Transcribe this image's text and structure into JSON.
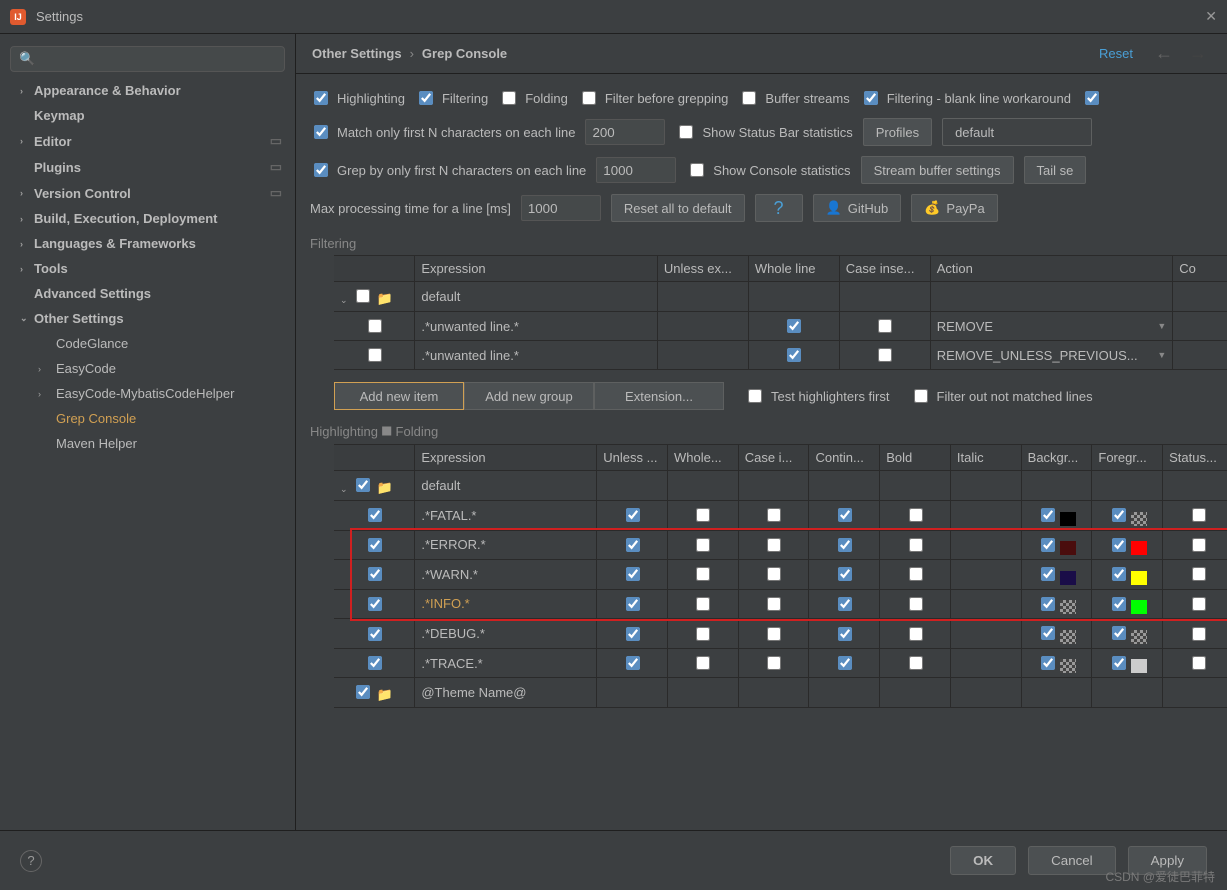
{
  "titlebar": {
    "title": "Settings"
  },
  "search": {
    "placeholder": "Q▾"
  },
  "sidebar": {
    "items": [
      {
        "label": "Appearance & Behavior",
        "chev": ">"
      },
      {
        "label": "Keymap",
        "chev": ""
      },
      {
        "label": "Editor",
        "chev": ">",
        "dots": true
      },
      {
        "label": "Plugins",
        "chev": "",
        "dots": true
      },
      {
        "label": "Version Control",
        "chev": ">",
        "dots": true
      },
      {
        "label": "Build, Execution, Deployment",
        "chev": ">"
      },
      {
        "label": "Languages & Frameworks",
        "chev": ">"
      },
      {
        "label": "Tools",
        "chev": ">"
      },
      {
        "label": "Advanced Settings",
        "chev": ""
      },
      {
        "label": "Other Settings",
        "chev": "v"
      }
    ],
    "children": [
      {
        "label": "CodeGlance"
      },
      {
        "label": "EasyCode",
        "chev": ">"
      },
      {
        "label": "EasyCode-MybatisCodeHelper",
        "chev": ">"
      },
      {
        "label": "Grep Console",
        "selected": true
      },
      {
        "label": "Maven Helper"
      }
    ]
  },
  "crumbs": {
    "a": "Other Settings",
    "b": "Grep Console",
    "reset": "Reset"
  },
  "options": {
    "highlighting": "Highlighting",
    "filtering": "Filtering",
    "folding": "Folding",
    "filterBefore": "Filter before grepping",
    "bufferStreams": "Buffer streams",
    "filteringWorkaround": "Filtering - blank line workaround",
    "matchFirstN": "Match only first N characters on each line",
    "matchN": "200",
    "showStatusBar": "Show Status Bar statistics",
    "profiles": "Profiles",
    "profileVal": "default",
    "grepFirstN": "Grep by only first N characters on each line",
    "grepN": "1000",
    "showConsole": "Show Console statistics",
    "streamBuffer": "Stream buffer settings",
    "tail": "Tail se",
    "maxTime": "Max processing time for a line [ms]",
    "maxTimeVal": "1000",
    "resetAll": "Reset all to default",
    "github": "GitHub",
    "paypal": "PayPa"
  },
  "filteringSection": "Filtering",
  "filtTable": {
    "cols": [
      "",
      "Expression",
      "Unless ex...",
      "Whole line",
      "Case inse...",
      "Action",
      "Co"
    ],
    "groupLabel": "default",
    "rows": [
      {
        "expr": ".*unwanted line.*",
        "whole": true,
        "case": false,
        "en": false,
        "action": "REMOVE"
      },
      {
        "expr": ".*unwanted line.*",
        "whole": true,
        "case": false,
        "en": false,
        "action": "REMOVE_UNLESS_PREVIOUS..."
      }
    ]
  },
  "actions": {
    "addItem": "Add new item",
    "addGroup": "Add new group",
    "extension": "Extension...",
    "testFirst": "Test highlighters first",
    "filterOut": "Filter out not matched lines"
  },
  "highlightSection": "Highlighting ⯀ Folding",
  "hlTable": {
    "cols": [
      "",
      "Expression",
      "Unless ...",
      "Whole...",
      "Case i...",
      "Contin...",
      "Bold",
      "Italic",
      "Backgr...",
      "Foregr...",
      "Status..."
    ],
    "groupLabel": "default",
    "rows": [
      {
        "en": true,
        "expr": ".*FATAL.*",
        "un": true,
        "w": false,
        "c": false,
        "co": true,
        "b": false,
        "bg": "#000000",
        "fg": "checker"
      },
      {
        "en": true,
        "expr": ".*ERROR.*",
        "un": true,
        "w": false,
        "c": false,
        "co": true,
        "b": false,
        "bg": "#4a0d0d",
        "fg": "#ff0000"
      },
      {
        "en": true,
        "expr": ".*WARN.*",
        "un": true,
        "w": false,
        "c": false,
        "co": true,
        "b": false,
        "bg": "#1a0d48",
        "fg": "#ffff00"
      },
      {
        "en": true,
        "expr": ".*INFO.*",
        "un": true,
        "w": false,
        "c": false,
        "co": true,
        "b": false,
        "bg": "checker",
        "fg": "#00ff00",
        "orange": true
      },
      {
        "en": true,
        "expr": ".*DEBUG.*",
        "un": true,
        "w": false,
        "c": false,
        "co": true,
        "b": false,
        "bg": "checker",
        "fg": "checker"
      },
      {
        "en": true,
        "expr": ".*TRACE.*",
        "un": true,
        "w": false,
        "c": false,
        "co": true,
        "b": false,
        "bg": "checker",
        "fg": "#cccccc"
      }
    ],
    "theme": "@Theme Name@"
  },
  "footer": {
    "ok": "OK",
    "cancel": "Cancel",
    "apply": "Apply"
  },
  "watermark": "CSDN @爱徒巴菲特"
}
